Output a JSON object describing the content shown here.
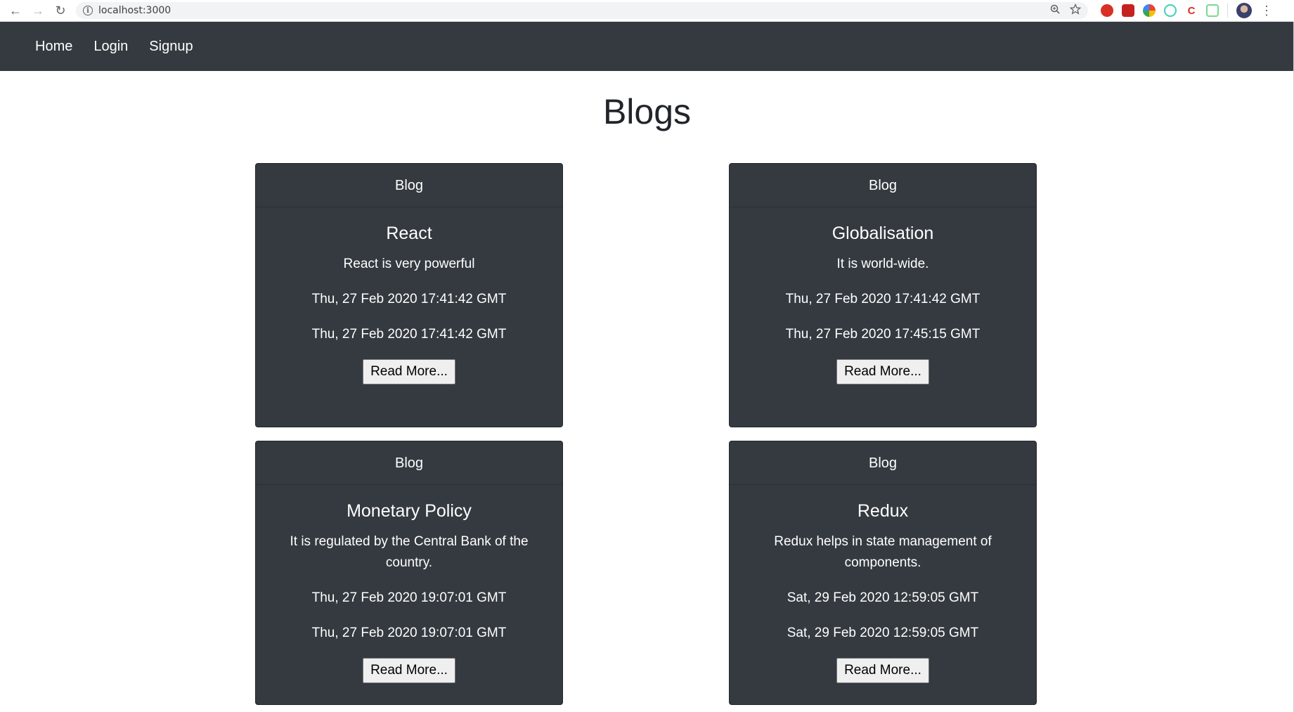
{
  "browser": {
    "url": "localhost:3000",
    "extensions": [
      "ext-red-circle-icon",
      "ext-red-square-icon",
      "ext-color-wheel-icon",
      "ext-teal-ring-icon",
      "ext-ci-icon",
      "ext-green-hex-icon"
    ]
  },
  "navbar": {
    "links": [
      "Home",
      "Login",
      "Signup"
    ]
  },
  "page": {
    "title": "Blogs"
  },
  "blogs": [
    {
      "header": "Blog",
      "title": "React",
      "text": "React is very powerful",
      "created": "Thu, 27 Feb 2020 17:41:42 GMT",
      "updated": "Thu, 27 Feb 2020 17:41:42 GMT",
      "button": "Read More..."
    },
    {
      "header": "Blog",
      "title": "Globalisation",
      "text": "It is world-wide.",
      "created": "Thu, 27 Feb 2020 17:41:42 GMT",
      "updated": "Thu, 27 Feb 2020 17:45:15 GMT",
      "button": "Read More..."
    },
    {
      "header": "Blog",
      "title": "Monetary Policy",
      "text": "It is regulated by the Central Bank of the country.",
      "created": "Thu, 27 Feb 2020 19:07:01 GMT",
      "updated": "Thu, 27 Feb 2020 19:07:01 GMT",
      "button": "Read More..."
    },
    {
      "header": "Blog",
      "title": "Redux",
      "text": "Redux helps in state management of components.",
      "created": "Sat, 29 Feb 2020 12:59:05 GMT",
      "updated": "Sat, 29 Feb 2020 12:59:05 GMT",
      "button": "Read More..."
    }
  ],
  "colors": {
    "navbar_bg": "#343a40",
    "card_bg": "#343a40",
    "page_bg": "#ffffff"
  }
}
